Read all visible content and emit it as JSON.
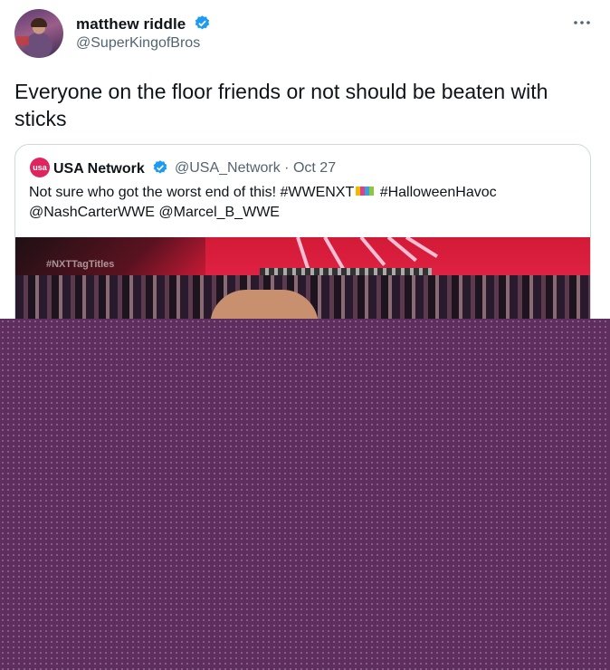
{
  "author": {
    "display_name": "matthew riddle",
    "handle": "@SuperKingofBros",
    "verified": true,
    "avatar_icon": "profile-avatar"
  },
  "tweet": {
    "text": "Everyone on the floor friends or not should be beaten with sticks"
  },
  "quoted": {
    "display_name": "USA Network",
    "avatar_text": "usa",
    "handle": "@USA_Network",
    "separator": "·",
    "date": "Oct 27",
    "verified": true,
    "text_line1": "Not sure who got the worst end of this! #WWENXT",
    "text_line1b": " #HalloweenHavoc",
    "text_line2": "@NashCarterWWE @Marcel_B_WWE",
    "media_watermark": "#NXTTagTitles"
  },
  "colors": {
    "verified_blue": "#1d9bf0",
    "secondary_text": "#536471",
    "redaction_purple": "#5e2e5e"
  },
  "icons": {
    "more": "more-options-icon",
    "verified": "verified-badge-icon"
  }
}
